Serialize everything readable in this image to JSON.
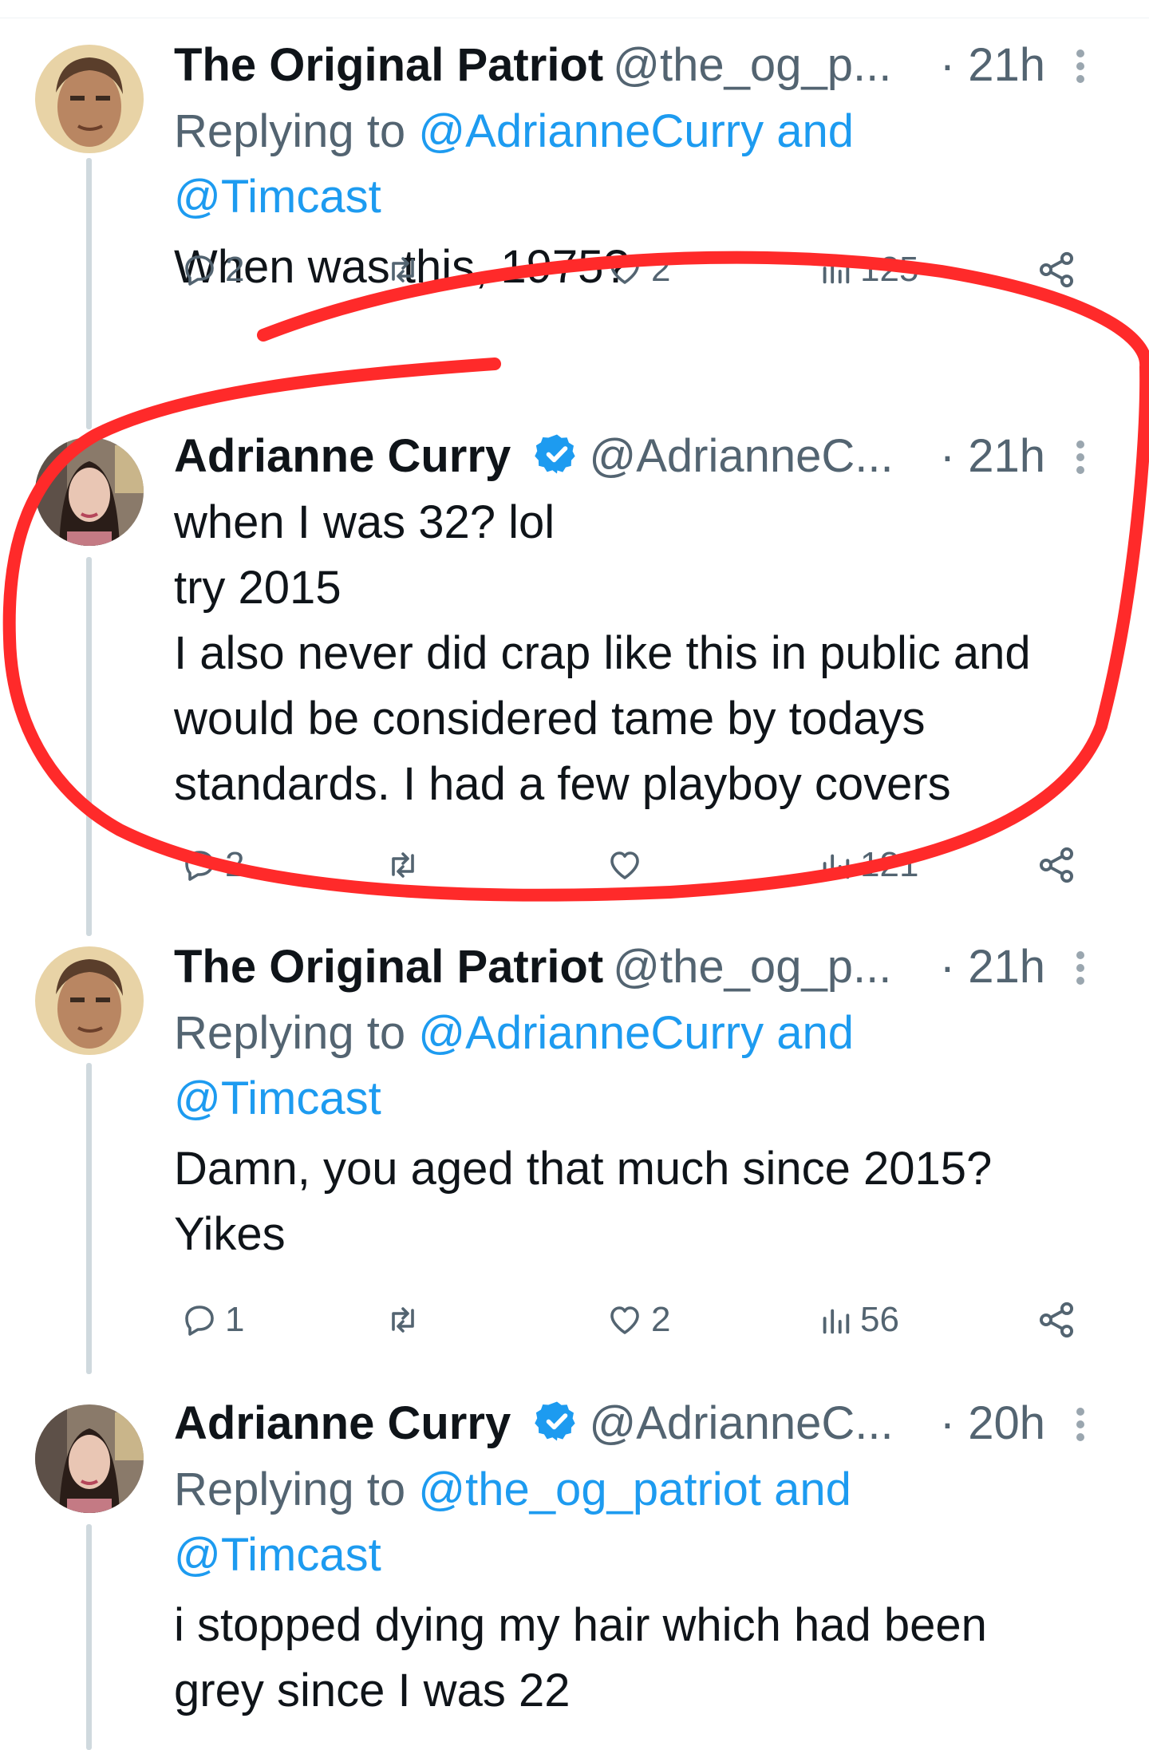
{
  "colors": {
    "link": "#1d9bf0",
    "muted": "#536471",
    "text": "#0f1419",
    "verified": "#1d9bf0",
    "annotation": "#ff2a2a"
  },
  "tweets": [
    {
      "name": "The Original Patriot",
      "handle": "@the_og_p...",
      "time": "· 21h",
      "verified": false,
      "reply_prefix": "Replying to ",
      "reply_link1": "@AdrianneCurry and",
      "reply_link2": "@Timcast",
      "text_lines": [
        "When was this, 1975?"
      ],
      "actions": {
        "reply": "2",
        "retweet": "",
        "like": "2",
        "views": "125"
      }
    },
    {
      "name": "Adrianne Curry",
      "handle": "@AdrianneC...",
      "time": "· 21h",
      "verified": true,
      "text_lines": [
        "when I was 32? lol",
        "try 2015",
        "I also never did crap like this in public and",
        "would be considered tame by todays",
        "standards. I had a few playboy covers"
      ],
      "actions": {
        "reply": "2",
        "retweet": "",
        "like": "",
        "views": "121"
      }
    },
    {
      "name": "The Original Patriot",
      "handle": "@the_og_p...",
      "time": "· 21h",
      "verified": false,
      "reply_prefix": "Replying to ",
      "reply_link1": "@AdrianneCurry and",
      "reply_link2": "@Timcast",
      "text_lines": [
        "Damn, you aged that much since 2015?",
        "Yikes"
      ],
      "actions": {
        "reply": "1",
        "retweet": "",
        "like": "2",
        "views": "56"
      }
    },
    {
      "name": "Adrianne Curry",
      "handle": "@AdrianneC...",
      "time": "· 20h",
      "verified": true,
      "reply_prefix": "Replying to ",
      "reply_link1": "@the_og_patriot and",
      "reply_link2": "@Timcast",
      "text_lines": [
        "i stopped dying my hair which had been",
        "grey since I was 22"
      ]
    }
  ]
}
